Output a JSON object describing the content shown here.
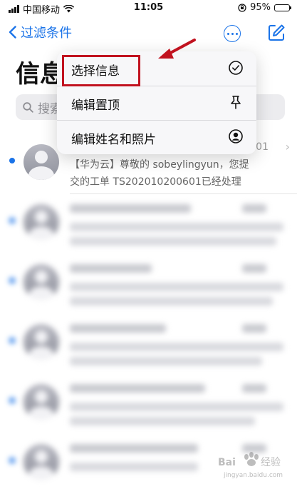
{
  "status_bar": {
    "carrier": "中国移动",
    "time": "11:05",
    "battery": "95%",
    "battery_level": 0.95
  },
  "nav": {
    "back_label": "过滤条件",
    "more_icon": "ellipsis-circle-icon",
    "compose_icon": "compose-icon"
  },
  "page": {
    "title": "信息"
  },
  "search": {
    "placeholder": "搜索"
  },
  "messages": [
    {
      "sender": "",
      "preview_line1": "【华为云】尊敬的 sobeylingyun，您提",
      "preview_line2": "交的工单 TS202010200601已经处理",
      "date": "01"
    }
  ],
  "menu": {
    "items": [
      {
        "label": "选择信息",
        "icon": "checkmark-circle-icon"
      },
      {
        "label": "编辑置顶",
        "icon": "pin-icon"
      },
      {
        "label": "编辑姓名和照片",
        "icon": "person-circle-icon"
      }
    ]
  },
  "watermark": {
    "text": "Bai经验",
    "sub": "jingyan.baidu.com"
  },
  "colors": {
    "accent": "#1a73e8",
    "highlight": "#c1121f"
  }
}
